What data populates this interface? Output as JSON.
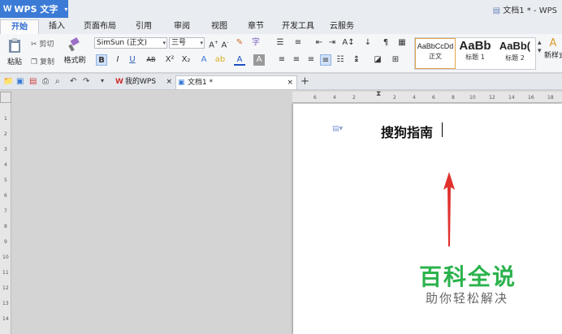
{
  "app": {
    "name": "WPS 文字",
    "doc_indicator": "文档1 * - WPS"
  },
  "ribbon_tabs": [
    {
      "label": "开始",
      "active": true
    },
    {
      "label": "插入"
    },
    {
      "label": "页面布局"
    },
    {
      "label": "引用"
    },
    {
      "label": "审阅"
    },
    {
      "label": "视图"
    },
    {
      "label": "章节"
    },
    {
      "label": "开发工具"
    },
    {
      "label": "云服务"
    }
  ],
  "clipboard": {
    "paste": "粘贴",
    "cut": "剪切",
    "copy": "复制",
    "format_painter": "格式刷"
  },
  "font": {
    "name": "SimSun (正文)",
    "size": "三号"
  },
  "format": {
    "bold": "B",
    "italic": "I",
    "underline": "U",
    "strike": "AB",
    "superscript": "X²",
    "subscript": "X₂"
  },
  "styles": [
    {
      "sample": "AaBbCcDd",
      "label": "正文"
    },
    {
      "sample": "AaBb",
      "label": "标题 1"
    },
    {
      "sample": "AaBb(",
      "label": "标题 2"
    }
  ],
  "new_style": "新样式",
  "doc_tabs": [
    {
      "label": "我的WPS",
      "icon": "W"
    },
    {
      "label": "文档1 *",
      "icon": "▣"
    }
  ],
  "ruler_h": [
    "6",
    "4",
    "2",
    "2",
    "4",
    "6",
    "8",
    "10",
    "12",
    "14",
    "16",
    "18"
  ],
  "ruler_v": [
    "1",
    "2",
    "3",
    "4",
    "5",
    "6",
    "7",
    "8",
    "9",
    "10",
    "11",
    "12",
    "13",
    "14"
  ],
  "document": {
    "title": "搜狗指南"
  },
  "watermark": {
    "title": "百科全说",
    "subtitle": "助你轻松解决"
  },
  "colors": {
    "accent": "#3b7bd6",
    "arrow": "#e0312d",
    "watermark": "#2bb24c"
  }
}
